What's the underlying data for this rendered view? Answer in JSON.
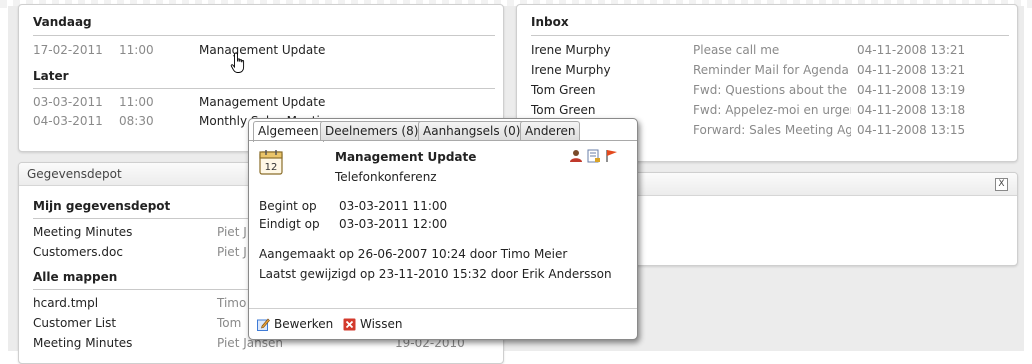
{
  "calendar": {
    "today_heading": "Vandaag",
    "today": [
      {
        "date": "17-02-2011",
        "time": "11:00",
        "title": "Management Update"
      }
    ],
    "later_heading": "Later",
    "later": [
      {
        "date": "03-03-2011",
        "time": "11:00",
        "title": "Management Update"
      },
      {
        "date": "04-03-2011",
        "time": "08:30",
        "title": "Monthly Sales Meeting"
      }
    ]
  },
  "inbox": {
    "heading": "Inbox",
    "messages": [
      {
        "from": "Irene Murphy",
        "subject": "Please call me",
        "date": "04-11-2008 13:21"
      },
      {
        "from": "Irene Murphy",
        "subject": "Reminder Mail for Agenda",
        "date": "04-11-2008 13:21"
      },
      {
        "from": "Tom Green",
        "subject": "Fwd: Questions about the m",
        "date": "04-11-2008 13:19"
      },
      {
        "from": "Tom Green",
        "subject": "Fwd: Appelez-moi en urgenc",
        "date": "04-11-2008 13:18"
      },
      {
        "from": "",
        "subject": "Forward: Sales Meeting Age",
        "date": "04-11-2008 13:15"
      }
    ]
  },
  "files": {
    "panel_title": "Gegevensdepot",
    "my_heading": "Mijn gegevensdepot",
    "my_items": [
      {
        "name": "Meeting Minutes",
        "owner": "Piet J"
      },
      {
        "name": "Customers.doc",
        "owner": "Piet J"
      }
    ],
    "all_heading": "Alle mappen",
    "all_items": [
      {
        "name": "hcard.tmpl",
        "owner": "Timo",
        "date": ""
      },
      {
        "name": "Customer List",
        "owner": "Tom",
        "date": ""
      },
      {
        "name": "Meeting Minutes",
        "owner": "Piet Jansen",
        "date": "19-02-2010"
      }
    ]
  },
  "widget": {
    "close_label": "X"
  },
  "popup": {
    "tabs": [
      {
        "label": "Algemeen",
        "active": true
      },
      {
        "label": "Deelnemers (8)",
        "active": false
      },
      {
        "label": "Aanhangsels (0)",
        "active": false
      },
      {
        "label": "Anderen",
        "active": false
      }
    ],
    "calendar_icon_day": "12",
    "title": "Management Update",
    "subtitle": "Telefonkonferenz",
    "start_label": "Begint op",
    "start_value": "03-03-2011 11:00",
    "end_label": "Eindigt op",
    "end_value": "03-03-2011 12:00",
    "created": "Aangemaakt op 26-06-2007 10:24 door Timo Meier",
    "modified": "Laatst gewijzigd op 23-11-2010 15:32 door Erik Andersson",
    "edit_label": "Bewerken",
    "delete_label": "Wissen",
    "icons": [
      "participants-icon",
      "export-icon",
      "flag-icon"
    ]
  },
  "colors": {
    "accent_edit": "#3f7bd6",
    "accent_delete": "#d33a2c",
    "flag": "#e34a1e"
  }
}
